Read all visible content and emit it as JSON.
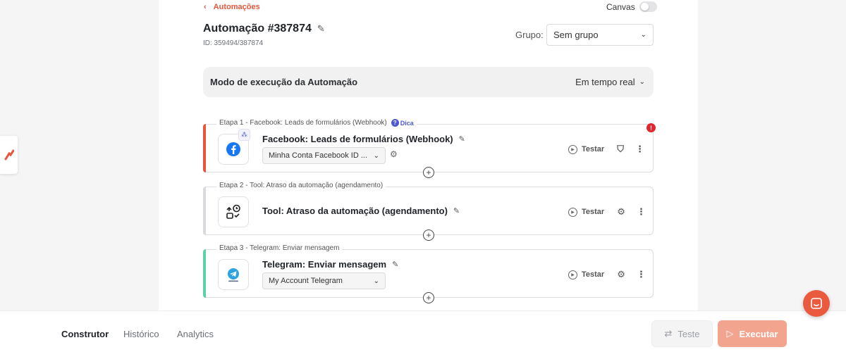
{
  "header": {
    "back_label": "Automações",
    "canvas_label": "Canvas",
    "title": "Automação #387874",
    "id_text": "ID: 359494/387874",
    "group_label": "Grupo:",
    "group_value": "Sem grupo"
  },
  "execution_mode": {
    "label": "Modo de execução da Automação",
    "value": "Em tempo real"
  },
  "steps": [
    {
      "caption": "Etapa 1 - Facebook: Leads de formulários (Webhook)",
      "tip": "Dica",
      "name": "Facebook: Leads de formulários (Webhook)",
      "account": "Minha Conta Facebook ID ...",
      "test_label": "Testar",
      "accent": "#e8553a",
      "icon": "facebook-icon"
    },
    {
      "caption": "Etapa 2 - Tool: Atraso da automação (agendamento)",
      "name": "Tool: Atraso da automação (agendamento)",
      "test_label": "Testar",
      "accent": "#d9dadd",
      "icon": "schedule-delay-icon"
    },
    {
      "caption": "Etapa 3 - Telegram: Enviar mensagem",
      "name": "Telegram: Enviar mensagem",
      "account": "My Account Telegram",
      "test_label": "Testar",
      "accent": "#5ad1a6",
      "icon": "telegram-icon"
    }
  ],
  "footer": {
    "tabs": [
      "Construtor",
      "Histórico",
      "Analytics"
    ],
    "test_button": "Teste",
    "run_button": "Executar"
  },
  "colors": {
    "brand": "#e8553a",
    "run_button": "#f2a48f",
    "alert": "#e0262f"
  }
}
